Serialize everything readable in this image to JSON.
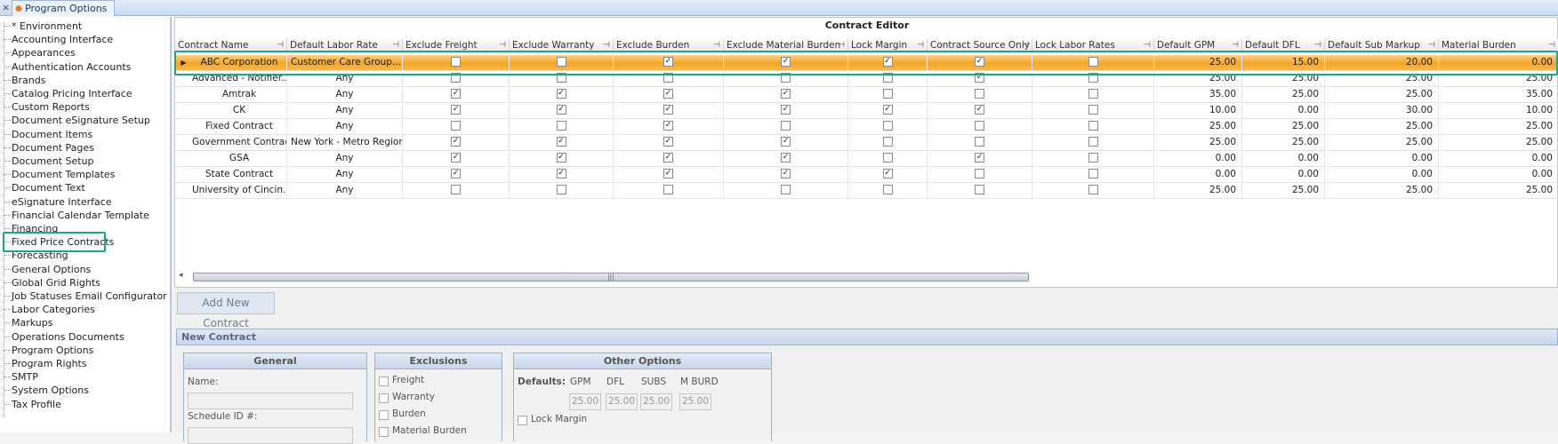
{
  "tab": {
    "close_glyph": "×",
    "label": "Program Options",
    "icon": "gear-icon"
  },
  "tree": {
    "items": [
      "* Environment",
      "Accounting Interface",
      "Appearances",
      "Authentication Accounts",
      "Brands",
      "Catalog Pricing Interface",
      "Custom Reports",
      "Document eSignature Setup",
      "Document Items",
      "Document Pages",
      "Document Setup",
      "Document Templates",
      "Document Text",
      "eSignature Interface",
      "Financial Calendar Template",
      "Financing",
      "Fixed Price Contracts",
      "Forecasting",
      "General Options",
      "Global Grid Rights",
      "Job Statuses Email Configurator",
      "Labor Categories",
      "Markups",
      "Operations Documents",
      "Program Options",
      "Program Rights",
      "SMTP",
      "System Options",
      "Tax Profile"
    ],
    "selected": "Fixed Price Contracts"
  },
  "grid": {
    "title": "Contract Editor",
    "columns": [
      "Contract Name",
      "Default Labor Rate",
      "Exclude Freight",
      "Exclude Warranty",
      "Exclude Burden",
      "Exclude Material Burden",
      "Lock Margin",
      "Contract Source Only",
      "Lock Labor Rates",
      "Default GPM",
      "Default DFL",
      "Default Sub Markup",
      "Material Burden"
    ],
    "rows": [
      {
        "name": "ABC Corporation",
        "rate": "Customer Care Group...",
        "checks": [
          false,
          false,
          true,
          true,
          true,
          true,
          false
        ],
        "gpm": "25.00",
        "dfl": "15.00",
        "sub": "20.00",
        "burden": "0.00",
        "selected": true
      },
      {
        "name": "Advanced - Notifier...",
        "rate": "Any",
        "checks": [
          false,
          false,
          false,
          false,
          false,
          true,
          false
        ],
        "gpm": "25.00",
        "dfl": "25.00",
        "sub": "25.00",
        "burden": "25.00"
      },
      {
        "name": "Amtrak",
        "rate": "Any",
        "checks": [
          true,
          true,
          true,
          true,
          false,
          false,
          false
        ],
        "gpm": "35.00",
        "dfl": "25.00",
        "sub": "25.00",
        "burden": "35.00"
      },
      {
        "name": "CK",
        "rate": "Any",
        "checks": [
          true,
          true,
          true,
          true,
          true,
          true,
          false
        ],
        "gpm": "10.00",
        "dfl": "0.00",
        "sub": "30.00",
        "burden": "10.00"
      },
      {
        "name": "Fixed Contract",
        "rate": "Any",
        "checks": [
          false,
          false,
          true,
          false,
          false,
          false,
          false
        ],
        "gpm": "25.00",
        "dfl": "25.00",
        "sub": "25.00",
        "burden": "25.00"
      },
      {
        "name": "Government Contract",
        "rate": "New York - Metro Region",
        "checks": [
          true,
          true,
          true,
          true,
          false,
          false,
          false
        ],
        "gpm": "25.00",
        "dfl": "25.00",
        "sub": "25.00",
        "burden": "25.00"
      },
      {
        "name": "GSA",
        "rate": "Any",
        "checks": [
          true,
          true,
          true,
          true,
          false,
          true,
          false
        ],
        "gpm": "0.00",
        "dfl": "0.00",
        "sub": "0.00",
        "burden": "0.00"
      },
      {
        "name": "State Contract",
        "rate": "Any",
        "checks": [
          true,
          true,
          true,
          true,
          true,
          false,
          false
        ],
        "gpm": "0.00",
        "dfl": "0.00",
        "sub": "0.00",
        "burden": "0.00"
      },
      {
        "name": "University of Cincin...",
        "rate": "Any",
        "checks": [
          false,
          false,
          false,
          false,
          false,
          false,
          false
        ],
        "gpm": "25.00",
        "dfl": "25.00",
        "sub": "25.00",
        "burden": "25.00"
      }
    ],
    "scroll_grip": "|||"
  },
  "add_button": "Add New Contract",
  "new_contract": {
    "title": "New Contract",
    "general": {
      "title": "General",
      "name_label": "Name:",
      "schedule_label": "Schedule ID #:"
    },
    "exclusions": {
      "title": "Exclusions",
      "items": [
        "Freight",
        "Warranty",
        "Burden",
        "Material Burden"
      ]
    },
    "other": {
      "title": "Other Options",
      "defaults_label": "Defaults:",
      "cols": [
        "GPM",
        "DFL",
        "SUBS",
        "M BURD"
      ],
      "values": [
        "25.00",
        "25.00",
        "25.00",
        "25.00"
      ],
      "lock_margin": "Lock Margin"
    }
  }
}
